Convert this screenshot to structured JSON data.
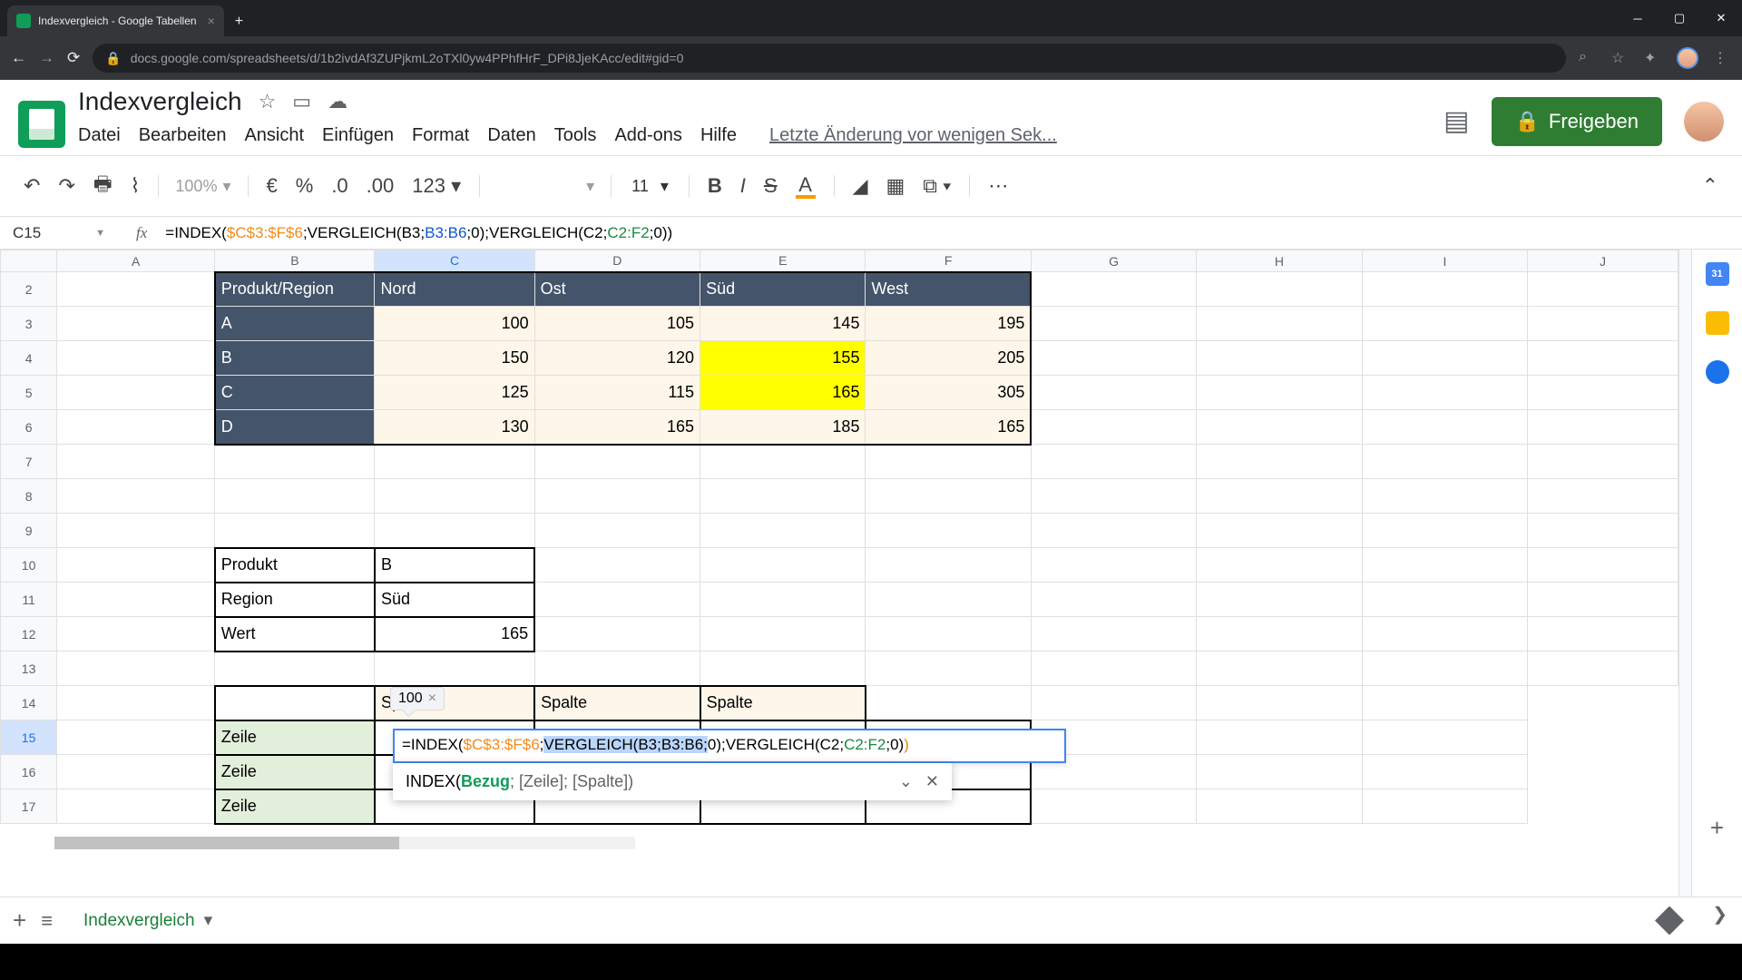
{
  "browser": {
    "tab_title": "Indexvergleich - Google Tabellen",
    "url": "docs.google.com/spreadsheets/d/1b2ivdAf3ZUPjkmL2oTXl0yw4PPhfHrF_DPi8JjeKAcc/edit#gid=0"
  },
  "doc": {
    "title": "Indexvergleich",
    "share_label": "Freigeben",
    "last_edit": "Letzte Änderung vor wenigen Sek...",
    "menus": [
      "Datei",
      "Bearbeiten",
      "Ansicht",
      "Einfügen",
      "Format",
      "Daten",
      "Tools",
      "Add-ons",
      "Hilfe"
    ]
  },
  "toolbar": {
    "zoom": "100%",
    "font_size": "11",
    "number_format": "123"
  },
  "name_box": "C15",
  "formula_bar": {
    "prefix": "=INDEX(",
    "range": "$C$3:$F$6",
    "mid1": ";VERGLEICH(B3;",
    "ref1": "B3:B6",
    "mid2": ";0);VERGLEICH(C2;",
    "ref2": "C2:F2",
    "suffix": ";0))"
  },
  "columns": [
    "A",
    "B",
    "C",
    "D",
    "E",
    "F",
    "G",
    "H",
    "I",
    "J"
  ],
  "rows": [
    "2",
    "3",
    "4",
    "5",
    "6",
    "7",
    "8",
    "9",
    "10",
    "11",
    "12",
    "13",
    "14",
    "15",
    "16",
    "17"
  ],
  "table": {
    "corner_label": "Produkt/Region",
    "regions": [
      "Nord",
      "Ost",
      "Süd",
      "West"
    ],
    "products": [
      "A",
      "B",
      "C",
      "D"
    ],
    "data": [
      [
        100,
        105,
        145,
        195
      ],
      [
        150,
        120,
        155,
        205
      ],
      [
        125,
        115,
        165,
        305
      ],
      [
        130,
        165,
        185,
        165
      ]
    ]
  },
  "lookup": {
    "l_produkt": "Produkt",
    "v_produkt": "B",
    "l_region": "Region",
    "v_region": "Süd",
    "l_wert": "Wert",
    "v_wert": "165"
  },
  "matrix": {
    "col_label": "Spalte",
    "row_label": "Zeile"
  },
  "editor": {
    "preview": "100",
    "p1": "=INDEX(",
    "p_range": "$C$3:$F$6",
    "p2": ";",
    "p_sel": "VERGLEICH(B3;B3:B6;",
    "p3": "0);VERGLEICH(C2;",
    "p_ref": "C2:F2",
    "p4": ";0)",
    "p5": ")",
    "help_fn": "INDEX(",
    "help_bez": "Bezug",
    "help_rest": "; [Zeile]; [Spalte])"
  },
  "sheet_tab": "Indexvergleich"
}
